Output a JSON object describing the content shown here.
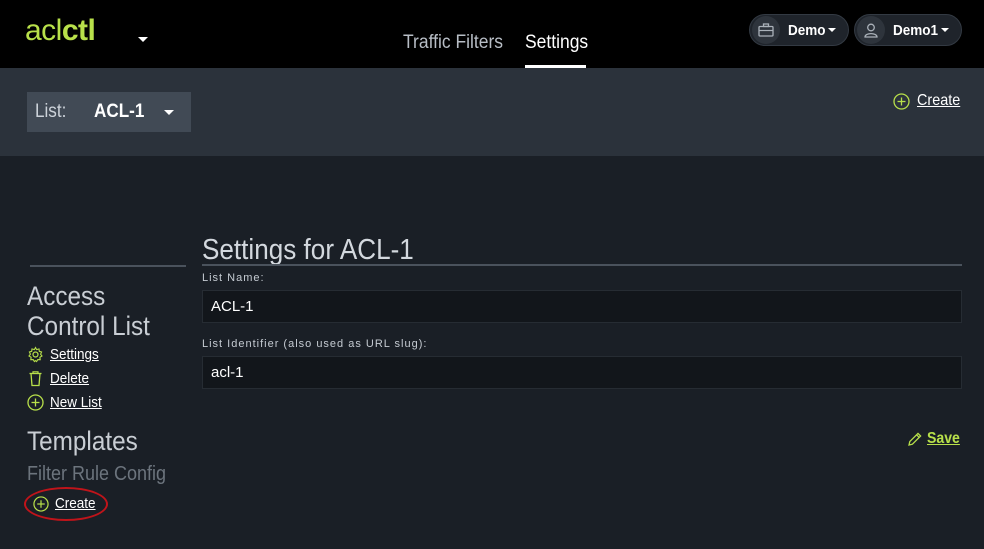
{
  "app": {
    "logo_light": "acl",
    "logo_bold": "ctl"
  },
  "nav": {
    "tabs": [
      {
        "label": "Traffic Filters",
        "active": false
      },
      {
        "label": "Settings",
        "active": true
      }
    ],
    "org_menu": {
      "label": "Demo",
      "icon": "briefcase-icon"
    },
    "user_menu": {
      "label": "Demo1",
      "icon": "user-icon"
    }
  },
  "subheader": {
    "list_label": "List:",
    "list_value": "ACL-1",
    "create_label": "Create"
  },
  "sidebar": {
    "section_title_line1": "Access",
    "section_title_line2": "Control List",
    "links": [
      {
        "label": "Settings",
        "icon": "gear-icon"
      },
      {
        "label": "Delete",
        "icon": "trash-icon"
      },
      {
        "label": "New List",
        "icon": "plus-circle-icon"
      }
    ],
    "templates_title": "Templates",
    "templates_sub": "Filter Rule Config",
    "templates_create": "Create"
  },
  "main": {
    "title": "Settings for ACL-1",
    "fields": [
      {
        "label": "List Name:",
        "value": "ACL-1"
      },
      {
        "label": "List Identifier (also used as URL slug):",
        "value": "acl-1"
      }
    ],
    "save_label": "Save"
  },
  "colors": {
    "accent": "#b8e04a",
    "background": "#1a1f26",
    "highlight": "#c0141a"
  }
}
